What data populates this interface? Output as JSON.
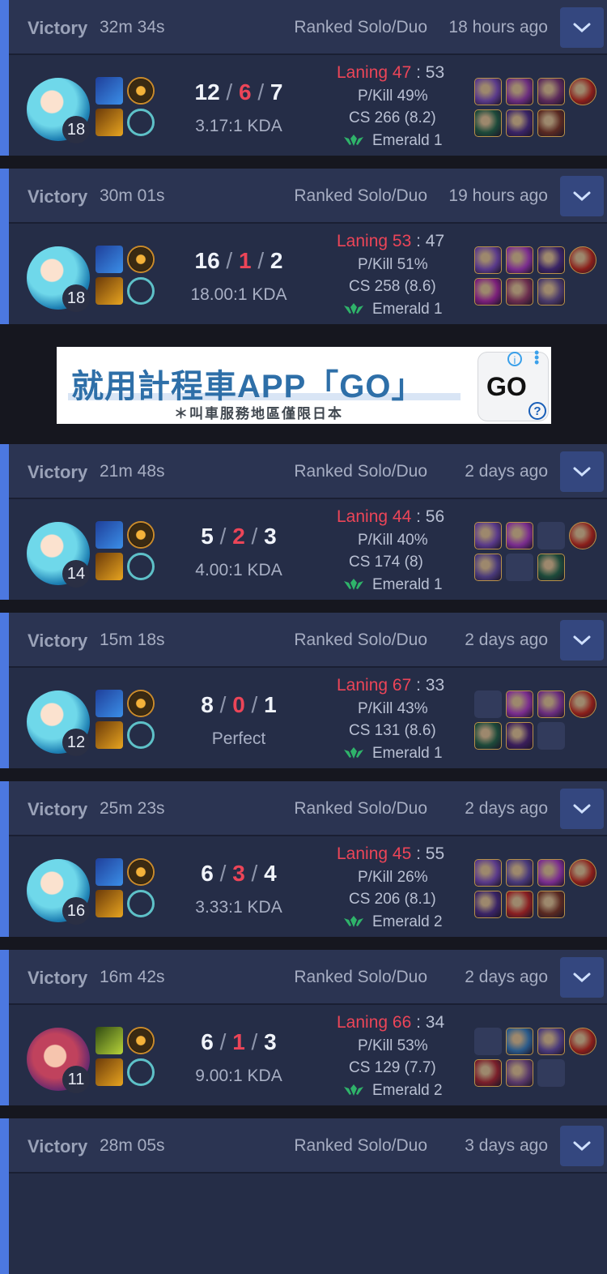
{
  "header_labels": {
    "kda_suffix": "KDA",
    "laning_label": "Laning",
    "pkill_label": "P/Kill",
    "cs_label": "CS"
  },
  "ad": {
    "headline": "就用計程車APP「GO」",
    "sub": "＊叫車服務地區僅限日本",
    "logo_text": "GO",
    "info_glyph": "i",
    "help_glyph": "?"
  },
  "matches": [
    {
      "result": "Victory",
      "duration": "32m 34s",
      "queue": "Ranked Solo/Duo",
      "ago": "18 hours ago",
      "champ": "blue",
      "level": "18",
      "k": "12",
      "d": "6",
      "a": "7",
      "ratio": "3.17:1 KDA",
      "laning": "47",
      "laning_opp": "53",
      "pkill": "P/Kill 49%",
      "cs": "CS 266 (8.2)",
      "rank": "Emerald 1",
      "items": [
        "#5a3a8a",
        "#6a2d7e",
        "#5b2a5a",
        "#8a1f1a",
        "#1d4a3a",
        "#3a2466",
        "#5a2a22",
        "",
        ""
      ]
    },
    {
      "result": "Victory",
      "duration": "30m 01s",
      "queue": "Ranked Solo/Duo",
      "ago": "19 hours ago",
      "champ": "blue",
      "level": "18",
      "k": "16",
      "d": "1",
      "a": "2",
      "ratio": "18.00:1 KDA",
      "laning": "53",
      "laning_opp": "47",
      "pkill": "P/Kill 51%",
      "cs": "CS 258 (8.6)",
      "rank": "Emerald 1",
      "items": [
        "#5a3a8a",
        "#7a2d8e",
        "#3a2466",
        "#8a1f1a",
        "#7a1f7a",
        "#6a2d4e",
        "#4a3a6a",
        "",
        ""
      ]
    },
    {
      "result": "Victory",
      "duration": "21m 48s",
      "queue": "Ranked Solo/Duo",
      "ago": "2 days ago",
      "champ": "blue",
      "level": "14",
      "k": "5",
      "d": "2",
      "a": "3",
      "ratio": "4.00:1 KDA",
      "laning": "44",
      "laning_opp": "56",
      "pkill": "P/Kill 40%",
      "cs": "CS 174 (8)",
      "rank": "Emerald 1",
      "items": [
        "#5a3a8a",
        "#7a2d8e",
        "",
        "#8a1f1a",
        "#4a3a7a",
        "",
        "#1d4a3a",
        "",
        ""
      ]
    },
    {
      "result": "Victory",
      "duration": "15m 18s",
      "queue": "Ranked Solo/Duo",
      "ago": "2 days ago",
      "champ": "blue",
      "level": "12",
      "k": "8",
      "d": "0",
      "a": "1",
      "ratio": "Perfect",
      "laning": "67",
      "laning_opp": "33",
      "pkill": "P/Kill 43%",
      "cs": "CS 131 (8.6)",
      "rank": "Emerald 1",
      "items": [
        "",
        "#7a2d8e",
        "#6a2d7e",
        "#8a1f1a",
        "#1d4a3a",
        "#3a1e5a",
        "",
        "",
        ""
      ]
    },
    {
      "result": "Victory",
      "duration": "25m 23s",
      "queue": "Ranked Solo/Duo",
      "ago": "2 days ago",
      "champ": "blue",
      "level": "16",
      "k": "6",
      "d": "3",
      "a": "4",
      "ratio": "3.33:1 KDA",
      "laning": "45",
      "laning_opp": "55",
      "pkill": "P/Kill 26%",
      "cs": "CS 206 (8.1)",
      "rank": "Emerald 2",
      "items": [
        "#5a3a8a",
        "#4a3a7a",
        "#7a2d8e",
        "#8a1f1a",
        "#3a2466",
        "#8a1f22",
        "#5a2a22",
        "",
        ""
      ]
    },
    {
      "result": "Victory",
      "duration": "16m 42s",
      "queue": "Ranked Solo/Duo",
      "ago": "2 days ago",
      "champ": "purple",
      "level": "11",
      "k": "6",
      "d": "1",
      "a": "3",
      "ratio": "9.00:1 KDA",
      "laning": "66",
      "laning_opp": "34",
      "pkill": "P/Kill 53%",
      "cs": "CS 129 (7.7)",
      "rank": "Emerald 2",
      "items": [
        "",
        "#2a5a8a",
        "#4a3a7a",
        "#8a1f1a",
        "#7a1f2a",
        "#5a3a6a",
        "",
        "",
        ""
      ]
    },
    {
      "result": "Victory",
      "duration": "28m 05s",
      "queue": "Ranked Solo/Duo",
      "ago": "3 days ago",
      "champ": "blue",
      "level": "",
      "k": "",
      "d": "",
      "a": "",
      "ratio": "",
      "laning": "",
      "laning_opp": "",
      "pkill": "",
      "cs": "",
      "rank": "",
      "items": []
    }
  ]
}
